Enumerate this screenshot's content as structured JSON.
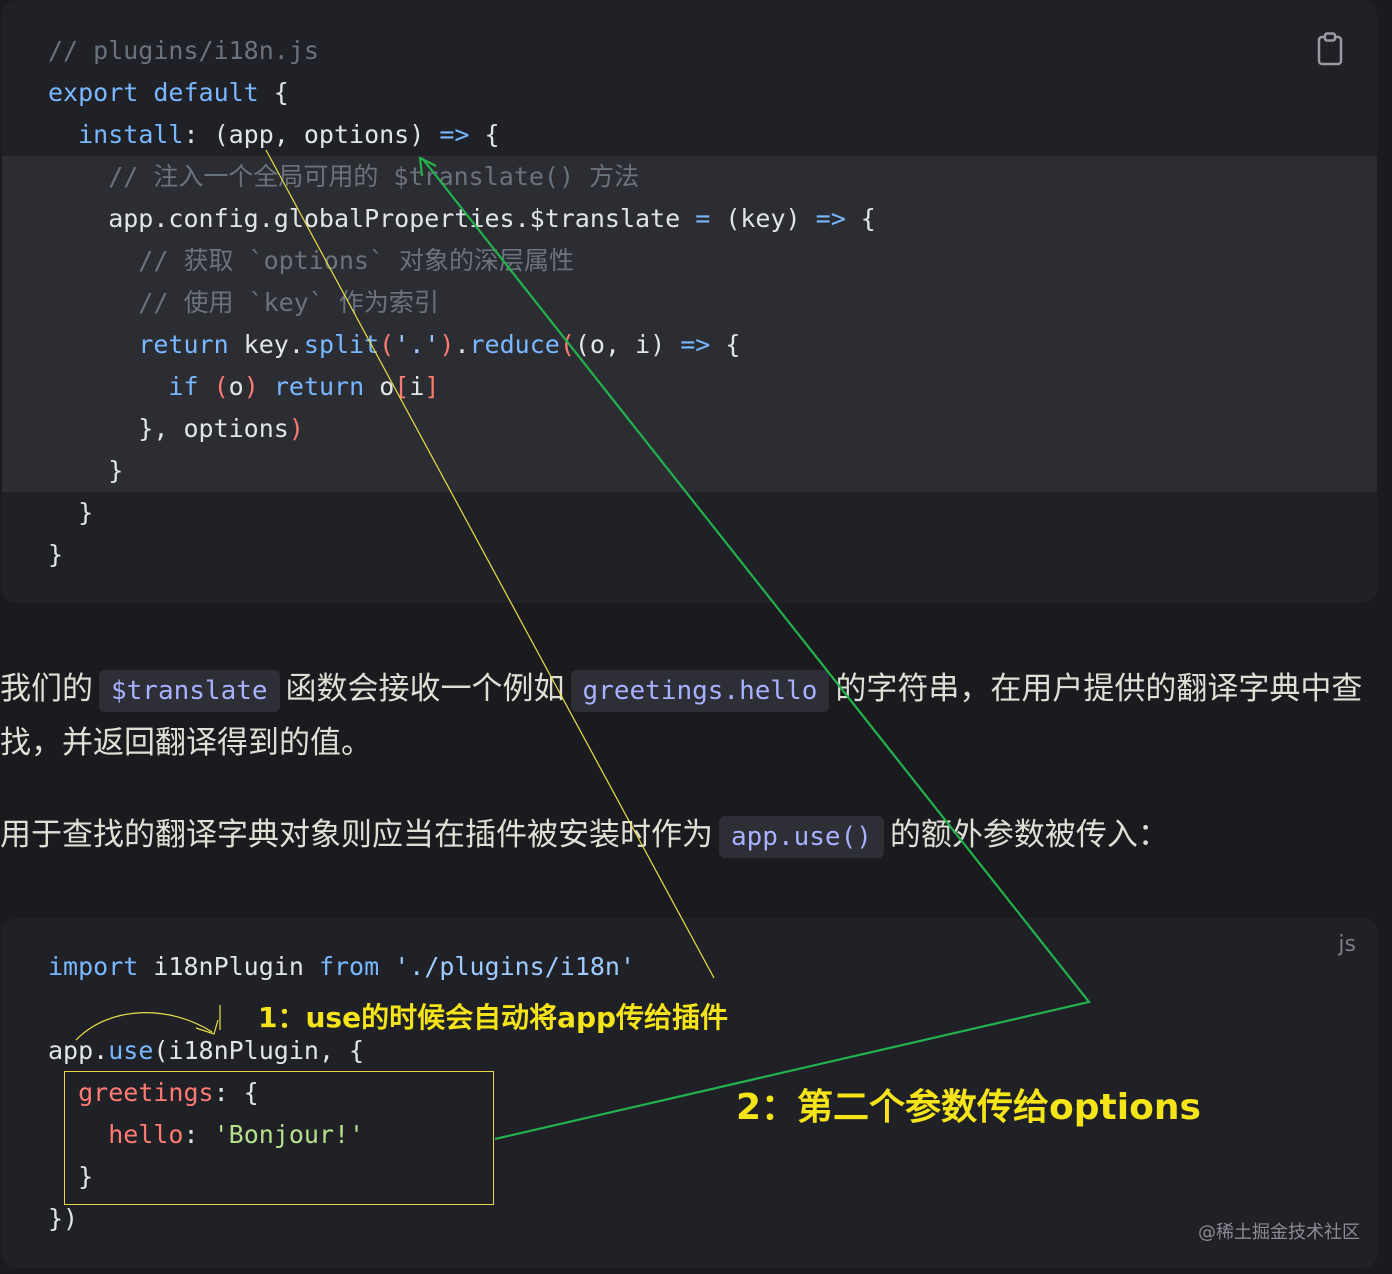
{
  "code_block_1": {
    "lines": [
      [
        [
          "t-cm",
          "// plugins/i18n.js"
        ]
      ],
      [
        [
          "t-kw",
          "export"
        ],
        [
          "t-txt",
          " "
        ],
        [
          "t-kw",
          "default"
        ],
        [
          "t-txt",
          " {"
        ]
      ],
      [
        [
          "t-txt",
          "  "
        ],
        [
          "t-kw",
          "install"
        ],
        [
          "t-txt",
          ": (app, options) "
        ],
        [
          "t-kw",
          "=>"
        ],
        [
          "t-txt",
          " {"
        ]
      ],
      [
        [
          "t-cm",
          "    // 注入一个全局可用的 $translate() 方法"
        ]
      ],
      [
        [
          "t-txt",
          "    app.config.globalProperties.$translate "
        ],
        [
          "t-kw",
          "="
        ],
        [
          "t-txt",
          " (key) "
        ],
        [
          "t-kw",
          "=>"
        ],
        [
          "t-txt",
          " {"
        ]
      ],
      [
        [
          "t-cm",
          "      // 获取 `options` 对象的深层属性"
        ]
      ],
      [
        [
          "t-cm",
          "      // 使用 `key` 作为索引"
        ]
      ],
      [
        [
          "t-txt",
          "      "
        ],
        [
          "t-kw",
          "return"
        ],
        [
          "t-txt",
          " key."
        ],
        [
          "t-fn",
          "split"
        ],
        [
          "t-prop",
          "("
        ],
        [
          "t-str",
          "'.'"
        ],
        [
          "t-prop",
          ")"
        ],
        [
          "t-txt",
          "."
        ],
        [
          "t-fn",
          "reduce"
        ],
        [
          "t-prop",
          "("
        ],
        [
          "t-txt",
          "(o, i) "
        ],
        [
          "t-kw",
          "=>"
        ],
        [
          "t-txt",
          " {"
        ]
      ],
      [
        [
          "t-txt",
          "        "
        ],
        [
          "t-kw",
          "if"
        ],
        [
          "t-txt",
          " "
        ],
        [
          "t-prop",
          "("
        ],
        [
          "t-txt",
          "o"
        ],
        [
          "t-prop",
          ")"
        ],
        [
          "t-txt",
          " "
        ],
        [
          "t-kw",
          "return"
        ],
        [
          "t-txt",
          " o"
        ],
        [
          "t-prop",
          "["
        ],
        [
          "t-txt",
          "i"
        ],
        [
          "t-prop",
          "]"
        ]
      ],
      [
        [
          "t-txt",
          "      }, options"
        ],
        [
          "t-prop",
          ")"
        ]
      ],
      [
        [
          "t-txt",
          "    }"
        ]
      ],
      [
        [
          "t-txt",
          "  }"
        ]
      ],
      [
        [
          "t-txt",
          "}"
        ]
      ]
    ]
  },
  "paragraph_1": {
    "before": "我们的",
    "code1": "$translate",
    "middle": "函数会接收一个例如",
    "code2": "greetings.hello",
    "after": "的字符串，在用户提供的翻译字典中查找，并返回翻译得到的值。"
  },
  "paragraph_2": {
    "before": "用于查找的翻译字典对象则应当在插件被安装时作为",
    "code1": "app.use()",
    "after": "的额外参数被传入："
  },
  "code_block_2": {
    "lang": "js",
    "lines": [
      [
        [
          "t-kw",
          "import"
        ],
        [
          "t-txt",
          " i18nPlugin "
        ],
        [
          "t-kw",
          "from"
        ],
        [
          "t-txt",
          " "
        ],
        [
          "t-str",
          "'./plugins/i18n'"
        ]
      ],
      [
        [
          "t-txt",
          ""
        ]
      ],
      [
        [
          "t-txt",
          "app."
        ],
        [
          "t-fn",
          "use"
        ],
        [
          "t-txt",
          "(i18nPlugin, {"
        ]
      ],
      [
        [
          "t-txt",
          "  "
        ],
        [
          "t-prop",
          "greetings"
        ],
        [
          "t-txt",
          ": {"
        ]
      ],
      [
        [
          "t-txt",
          "    "
        ],
        [
          "t-prop",
          "hello"
        ],
        [
          "t-txt",
          ": "
        ],
        [
          "t-str2",
          "'Bonjour!'"
        ]
      ],
      [
        [
          "t-txt",
          "  }"
        ]
      ],
      [
        [
          "t-txt",
          "})"
        ]
      ]
    ]
  },
  "annotations": {
    "note1": "1：use的时候会自动将app传给插件",
    "note2": "2：第二个参数传给options",
    "yellow_color": "#f5e417",
    "green_color": "#22b14c"
  },
  "watermark": "@稀土掘金技术社区",
  "icons": {
    "copy": "clipboard-icon"
  }
}
